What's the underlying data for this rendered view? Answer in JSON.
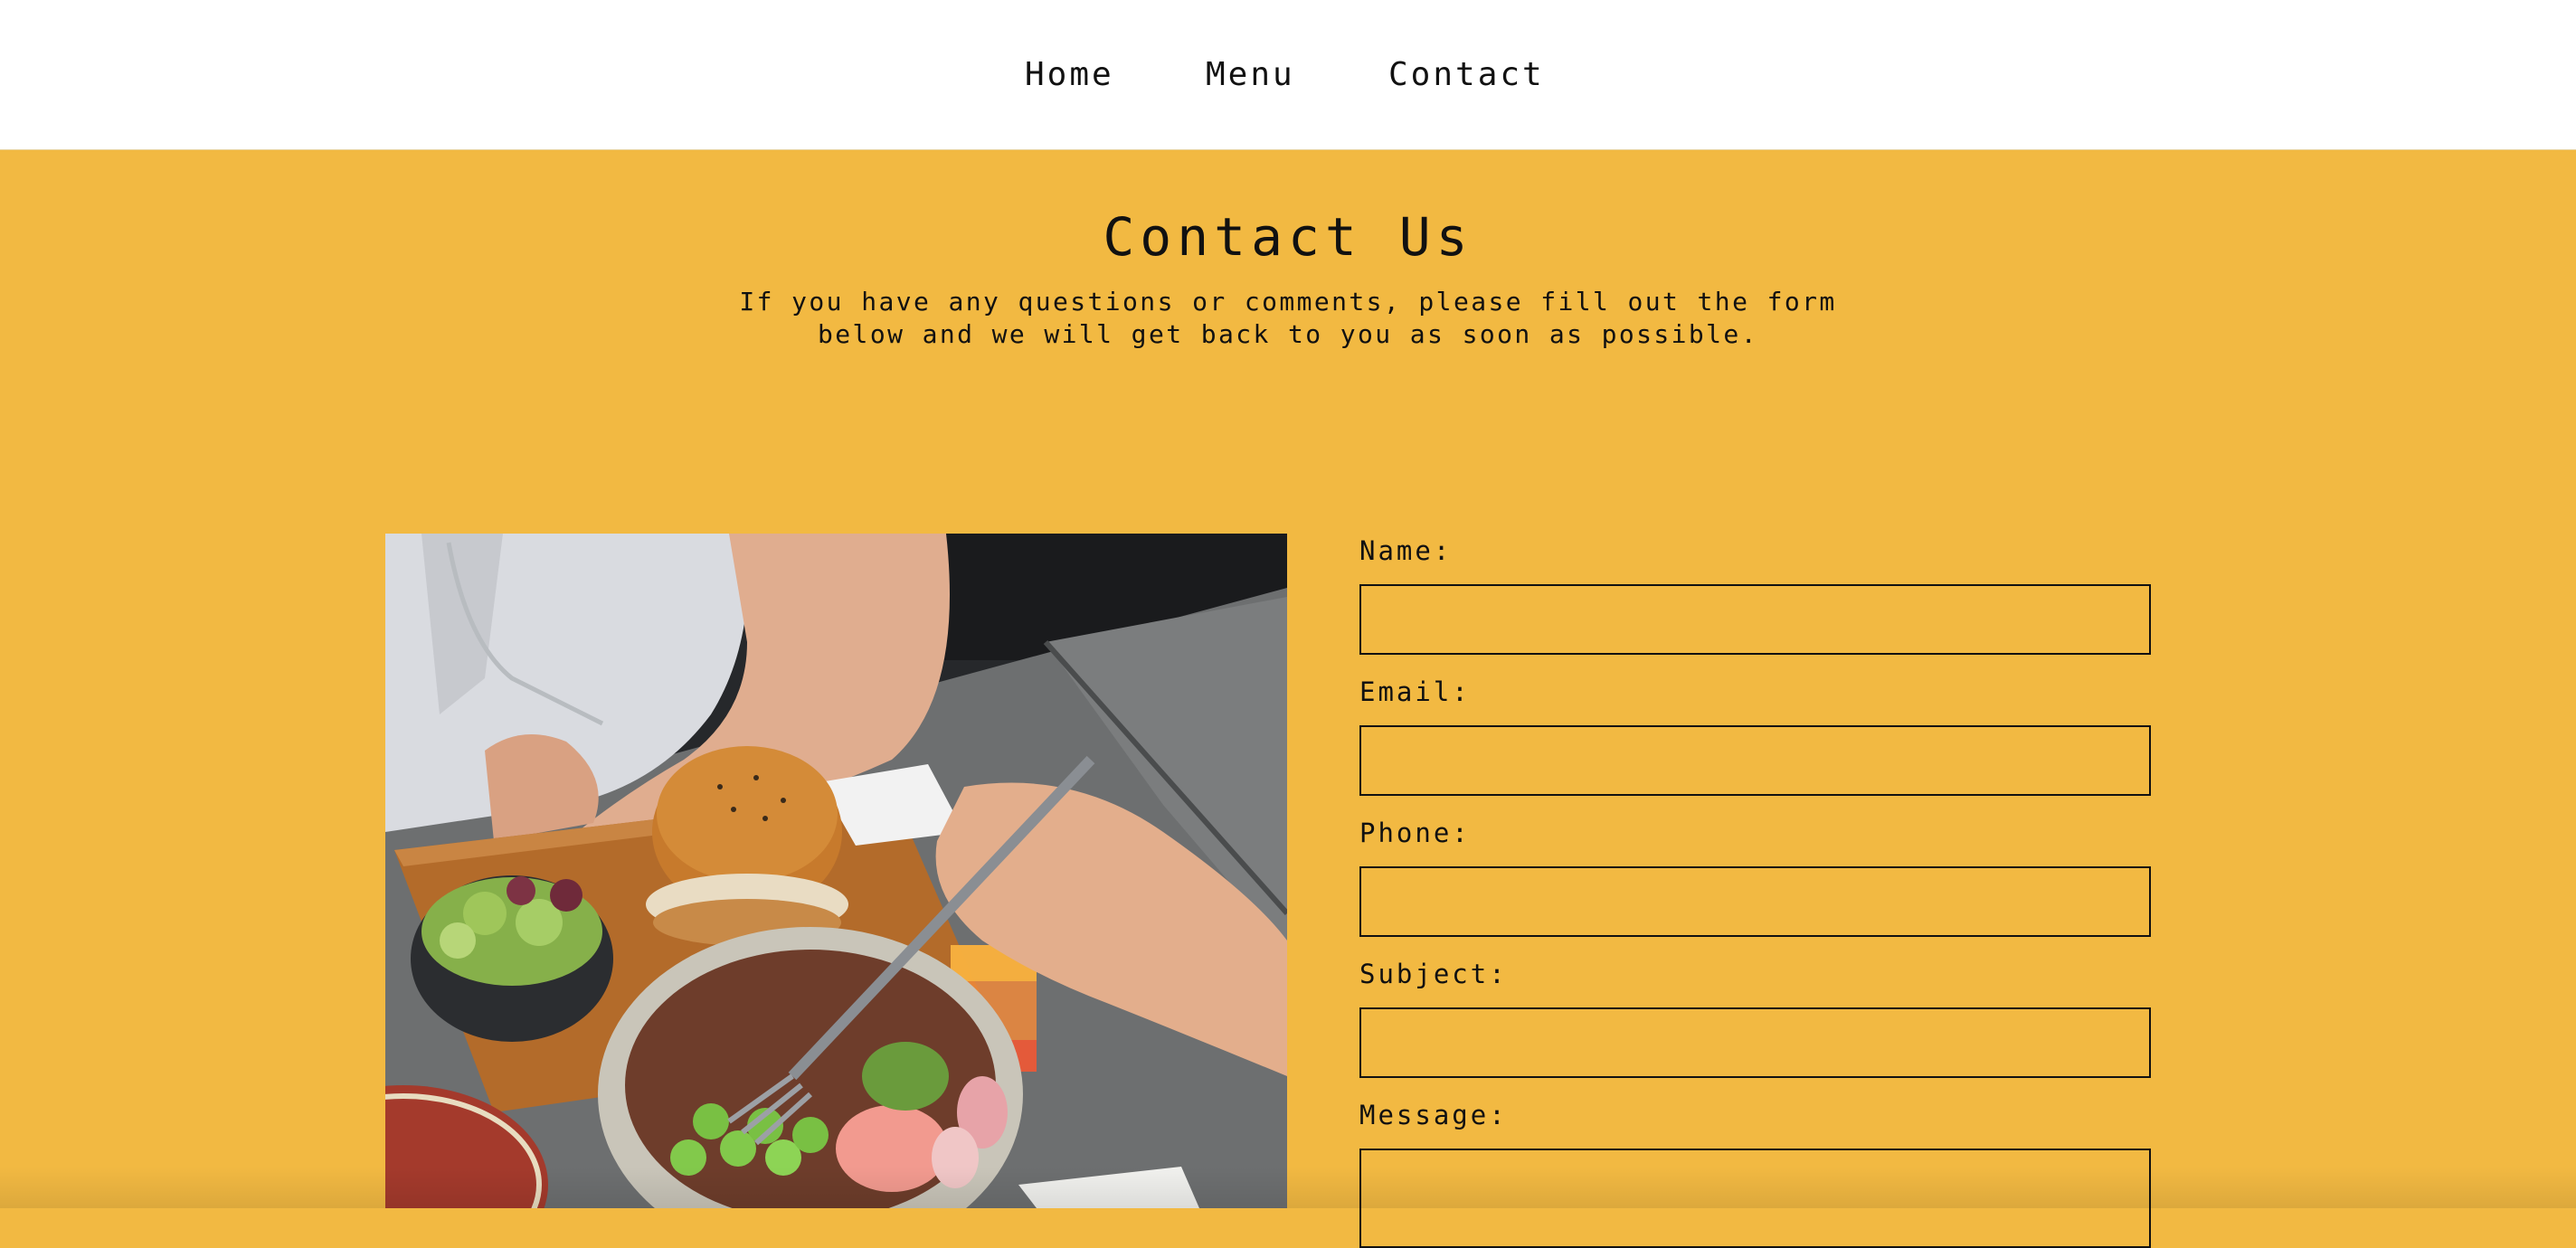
{
  "nav": {
    "items": [
      {
        "label": "Home"
      },
      {
        "label": "Menu"
      },
      {
        "label": "Contact"
      }
    ]
  },
  "hero": {
    "title": "Contact Us",
    "subtitle_line1": "If you have any questions or comments, please fill out the form",
    "subtitle_line2": "below and we will get back to you as soon as possible."
  },
  "form": {
    "fields": [
      {
        "label": "Name:",
        "value": ""
      },
      {
        "label": "Email:",
        "value": ""
      },
      {
        "label": "Phone:",
        "value": ""
      },
      {
        "label": "Subject:",
        "value": ""
      },
      {
        "label": "Message:",
        "value": ""
      }
    ]
  },
  "colors": {
    "page_background": "#f2b942",
    "nav_background": "#ffffff",
    "text": "#111111",
    "input_border": "#111111"
  },
  "image": {
    "alt": "food-photo"
  }
}
